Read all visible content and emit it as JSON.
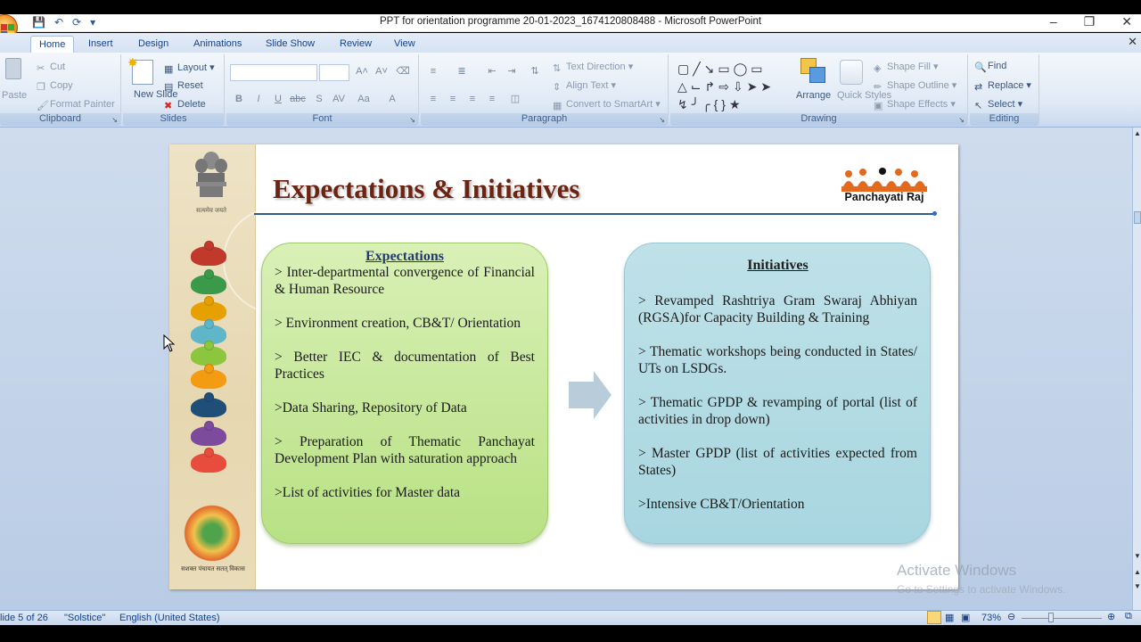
{
  "window": {
    "title": "PPT for  orientation programme 20-01-2023_1674120808488 - Microsoft PowerPoint"
  },
  "tabs": [
    "Home",
    "Insert",
    "Design",
    "Animations",
    "Slide Show",
    "Review",
    "View"
  ],
  "ribbon": {
    "clipboard": {
      "label": "Clipboard",
      "paste": "Paste",
      "cut": "Cut",
      "copy": "Copy",
      "format_painter": "Format Painter"
    },
    "slides": {
      "label": "Slides",
      "new_slide": "New Slide",
      "layout": "Layout",
      "reset": "Reset",
      "delete": "Delete"
    },
    "font": {
      "label": "Font"
    },
    "paragraph": {
      "label": "Paragraph",
      "text_direction": "Text Direction",
      "align_text": "Align Text",
      "convert_smartart": "Convert to SmartArt"
    },
    "drawing": {
      "label": "Drawing",
      "arrange": "Arrange",
      "quick_styles": "Quick Styles",
      "shape_fill": "Shape Fill",
      "shape_outline": "Shape Outline",
      "shape_effects": "Shape Effects"
    },
    "editing": {
      "label": "Editing",
      "find": "Find",
      "replace": "Replace",
      "select": "Select"
    }
  },
  "slide": {
    "title": "Expectations & Initiatives",
    "logo_text": "Panchayati Raj",
    "emblem_caption": "सत्यमेव जयते",
    "bottom_logo_caption": "सशक्त पंचायत सतत् विकास",
    "expectations": {
      "heading": "Expectations",
      "items": [
        "> Inter-departmental convergence of Financial & Human Resource",
        "> Environment creation, CB&T/ Orientation",
        "> Better IEC & documentation of Best Practices",
        ">Data Sharing, Repository of Data",
        "> Preparation of Thematic Panchayat Development Plan with saturation approach",
        ">List of activities for Master data"
      ]
    },
    "initiatives": {
      "heading": "Initiatives",
      "items": [
        "> Revamped Rashtriya Gram Swaraj Abhiyan (RGSA)for Capacity Building & Training",
        "> Thematic workshops being conducted in States/ UTs on LSDGs.",
        "> Thematic GPDP & revamping of portal (list of activities in drop down)",
        "> Master GPDP (list of activities expected from States)",
        ">Intensive CB&T/Orientation"
      ]
    }
  },
  "watermark": {
    "line1": "Activate Windows",
    "line2": "Go to Settings to activate Windows."
  },
  "status": {
    "slide_info": "lide 5 of 26",
    "theme": "\"Solstice\"",
    "language": "English (United States)",
    "zoom": "73%"
  },
  "colors": {
    "title": "#6b2412",
    "expectations_box": "#c9e89c",
    "initiatives_box": "#b3dbe4",
    "arrow": "#b8ccd9"
  }
}
